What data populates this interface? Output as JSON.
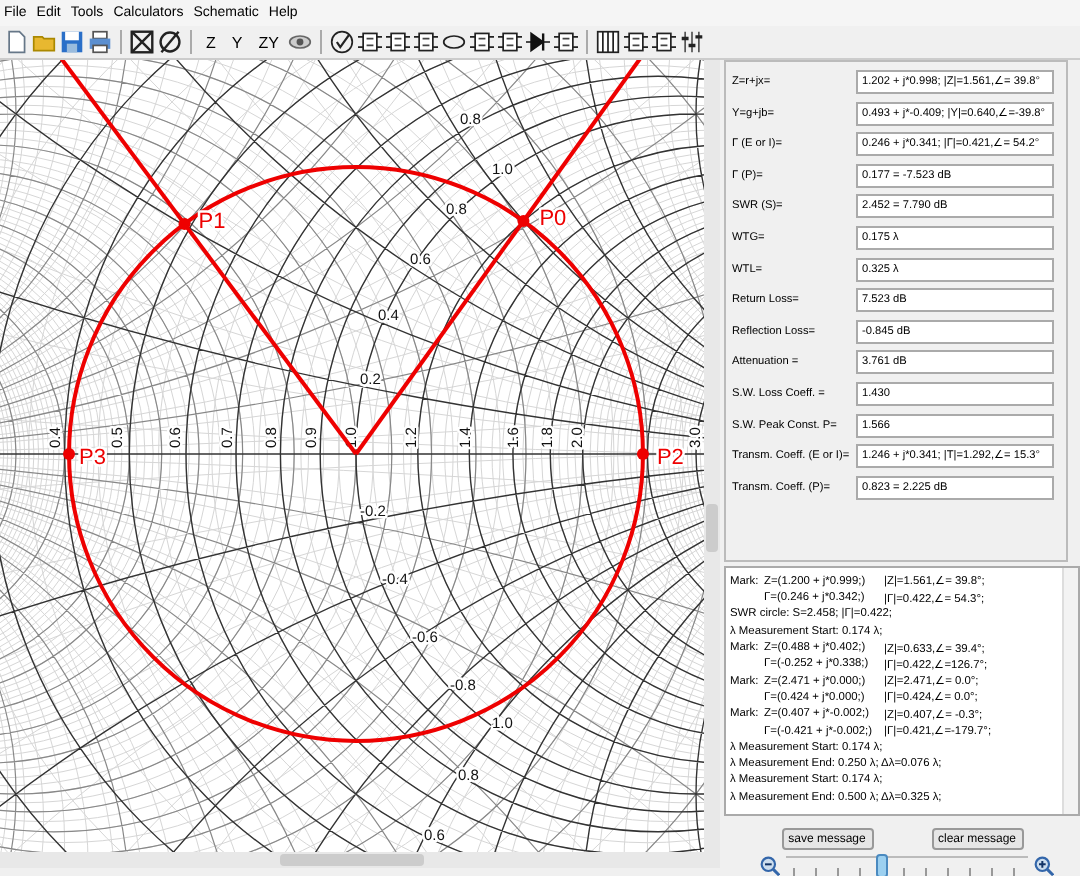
{
  "menu": [
    "File",
    "Edit",
    "Tools",
    "Calculators",
    "Schematic",
    "Help"
  ],
  "toolbar": {
    "text_buttons": [
      "Z",
      "Y",
      "ZY"
    ]
  },
  "chart": {
    "real_axis_labels": [
      "0.4",
      "0.5",
      "0.6",
      "0.7",
      "0.8",
      "0.9",
      "1.0",
      "1.2",
      "1.4",
      "1.6",
      "1.8",
      "2.0",
      "3.0"
    ],
    "reactance_labels": [
      "0.8",
      "1.0",
      "0.8",
      "0.6",
      "0.4",
      "0.2",
      "-0.2",
      "-0.4",
      "-0.6",
      "-0.8",
      "1.0",
      "0.8",
      "0.6"
    ],
    "markers": [
      {
        "label": "P0"
      },
      {
        "label": "P1"
      },
      {
        "label": "P2"
      },
      {
        "label": "P3"
      }
    ]
  },
  "parameters": [
    {
      "label": "Z=r+jx=",
      "value": "1.202 + j*0.998; |Z|=1.561,∠= 39.8°"
    },
    {
      "label": "Y=g+jb=",
      "value": "0.493 + j*-0.409; |Y|=0.640,∠=-39.8°"
    },
    {
      "label": "Γ (E or I)=",
      "value": "0.246 + j*0.341; |Γ|=0.421,∠= 54.2°"
    },
    {
      "label": "Γ (P)=",
      "value": "0.177 = -7.523 dB"
    },
    {
      "label": "SWR (S)=",
      "value": "2.452 = 7.790 dB"
    },
    {
      "label": "WTG=",
      "value": "0.175 λ"
    },
    {
      "label": "WTL=",
      "value": "0.325 λ"
    },
    {
      "label": "Return Loss=",
      "value": "7.523 dB"
    },
    {
      "label": "Reflection Loss=",
      "value": "-0.845 dB"
    },
    {
      "label": "Attenuation =",
      "value": "3.761 dB"
    },
    {
      "label": "S.W. Loss Coeff. =",
      "value": "1.430"
    },
    {
      "label": "S.W. Peak Const. P=",
      "value": "1.566"
    },
    {
      "label": "Transm. Coeff. (E or I)=",
      "value": "1.246 + j*0.341; |T|=1.292,∠= 15.3°"
    },
    {
      "label": "Transm. Coeff. (P)=",
      "value": "0.823 = 2.225 dB"
    }
  ],
  "log": [
    {
      "kind": "mark",
      "label": "Mark:",
      "value": "Z=(1.200 + j*0.999;)",
      "magnitude": "|Z|=1.561,∠= 39.8°;"
    },
    {
      "kind": "mark",
      "value": "Γ=(0.246 + j*0.342;)",
      "magnitude": "|Γ|=0.422,∠= 54.3°;"
    },
    {
      "kind": "note",
      "text": "SWR circle: S=2.458; |Γ|=0.422;"
    },
    {
      "kind": "note",
      "text": "λ Measurement Start: 0.174 λ;"
    },
    {
      "kind": "mark",
      "label": "Mark:",
      "value": "Z=(0.488 + j*0.402;)",
      "magnitude": "|Z|=0.633,∠= 39.4°;"
    },
    {
      "kind": "mark",
      "value": "Γ=(-0.252 + j*0.338;)",
      "magnitude": "|Γ|=0.422,∠=126.7°;"
    },
    {
      "kind": "mark",
      "label": "Mark:",
      "value": "Z=(2.471 + j*0.000;)",
      "magnitude": "|Z|=2.471,∠= 0.0°;"
    },
    {
      "kind": "mark",
      "value": "Γ=(0.424 + j*0.000;)",
      "magnitude": "|Γ|=0.424,∠= 0.0°;"
    },
    {
      "kind": "mark",
      "label": "Mark:",
      "value": "Z=(0.407 + j*-0.002;)",
      "magnitude": "|Z|=0.407,∠= -0.3°;"
    },
    {
      "kind": "mark",
      "value": "Γ=(-0.421 + j*-0.002;)",
      "magnitude": "|Γ|=0.421,∠=-179.7°;"
    },
    {
      "kind": "note",
      "text": "λ Measurement Start: 0.174 λ;"
    },
    {
      "kind": "note",
      "text": "λ Measurement End: 0.250 λ;  Δλ=0.076 λ;"
    },
    {
      "kind": "note",
      "text": "λ Measurement Start: 0.174 λ;"
    },
    {
      "kind": "note",
      "text": "λ Measurement End: 0.500 λ;  Δλ=0.325 λ;"
    }
  ],
  "buttons": [
    "save message",
    "clear message"
  ],
  "zoom": {
    "level": 0.4
  }
}
